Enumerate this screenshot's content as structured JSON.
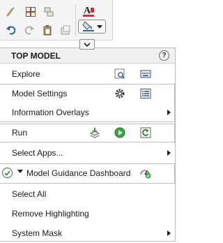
{
  "menu": {
    "title": "TOP MODEL",
    "help_symbol": "?",
    "items": {
      "explore": "Explore",
      "model_settings": "Model Settings",
      "information_overlays": "Information Overlays",
      "run": "Run",
      "select_apps": "Select Apps...",
      "model_guidance_dashboard": "Model Guidance Dashboard",
      "select_all": "Select All",
      "remove_highlighting": "Remove Highlighting",
      "system_mask": "System Mask"
    }
  },
  "icons": {
    "toolbar": [
      "brush-icon",
      "grid-select-icon",
      "copy-format-icon",
      "undo-icon",
      "redo-icon",
      "paste-icon",
      "clipboard-icon",
      "text-color-icon",
      "fill-color-icon",
      "chevron-down-icon"
    ],
    "rows": [
      "zoom-fit-icon",
      "keyboard-icon",
      "gear-icon",
      "list-icon",
      "step-icon",
      "run-icon",
      "refresh-icon",
      "check-icon",
      "dashboard-icon"
    ]
  },
  "colors": {
    "accent_green": "#2e7d32",
    "fill_swatch_blue": "#2a62c9",
    "text_color_red": "#d32f2f"
  }
}
